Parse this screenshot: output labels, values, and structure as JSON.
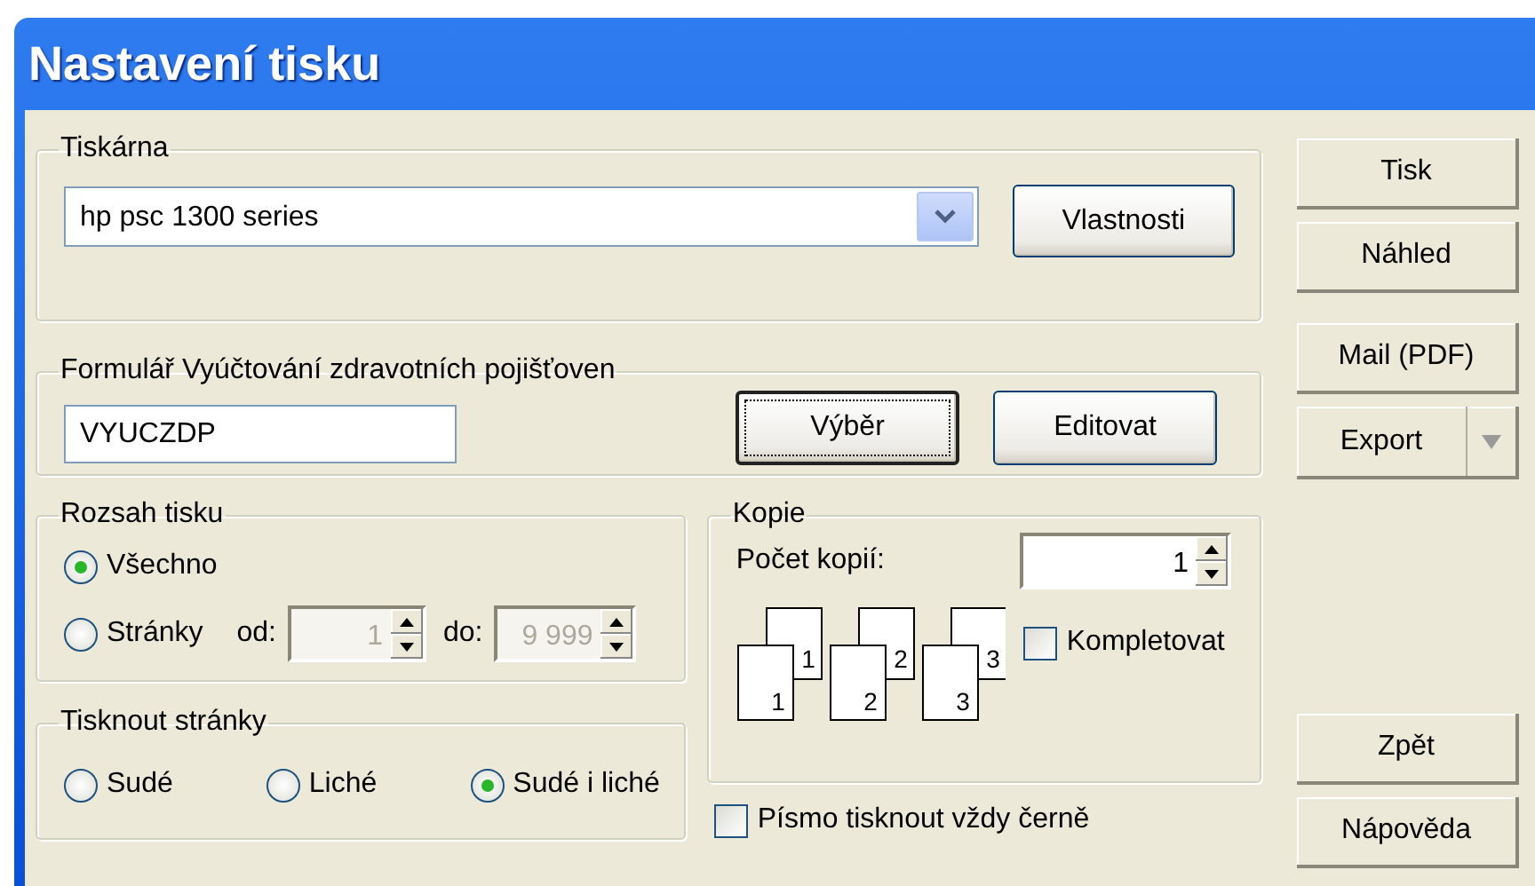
{
  "window": {
    "title": "Nastavení tisku"
  },
  "printer": {
    "label": "Tiskárna",
    "value": "hp psc 1300 series",
    "button": "Vlastnosti"
  },
  "form": {
    "label": "Formulář  Vyúčtování zdravotních pojišťoven",
    "value": "VYUCZDP",
    "buttons": [
      {
        "label": "Výběr",
        "default": true
      },
      {
        "label": "Editovat",
        "default": false
      }
    ]
  },
  "range": {
    "label": "Rozsah tisku",
    "options": [
      {
        "label": "Všechno",
        "selected": true
      },
      {
        "label": "Stránky",
        "selected": false
      }
    ],
    "from_label": "od:",
    "from": "1",
    "to_label": "do:",
    "to": "9 999",
    "disabled": true
  },
  "pages": {
    "label": "Tisknout stránky",
    "options": [
      {
        "label": "Sudé",
        "selected": false
      },
      {
        "label": "Liché",
        "selected": false
      },
      {
        "label": "Sudé i liché",
        "selected": true
      }
    ]
  },
  "copies": {
    "label": "Kopie",
    "count_label": "Počet kopií:",
    "count": "1",
    "stacks": [
      {
        "back": "1",
        "front": "1"
      },
      {
        "back": "2",
        "front": "2"
      },
      {
        "back": "3",
        "front": "3"
      }
    ],
    "collate": {
      "label": "Kompletovat",
      "checked": false
    }
  },
  "black_text": {
    "label": "Písmo tisknout vždy černě",
    "checked": false
  },
  "button_groups": [
    [
      {
        "label": "Tisk",
        "kind": "plain"
      },
      {
        "label": "Náhled",
        "kind": "plain"
      }
    ],
    [
      {
        "label": "Mail (PDF)",
        "kind": "plain"
      },
      {
        "label": "Export",
        "kind": "split"
      }
    ],
    [
      {
        "label": "Zpět",
        "kind": "plain"
      },
      {
        "label": "Nápověda",
        "kind": "plain"
      }
    ]
  ]
}
